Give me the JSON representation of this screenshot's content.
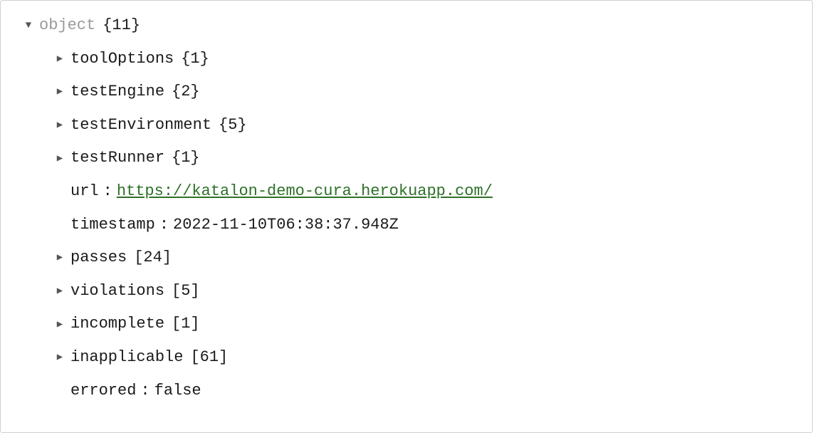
{
  "root": {
    "label": "object",
    "count": "{11}"
  },
  "children": [
    {
      "type": "expandable",
      "key": "toolOptions",
      "count": "{1}"
    },
    {
      "type": "expandable",
      "key": "testEngine",
      "count": "{2}"
    },
    {
      "type": "expandable",
      "key": "testEnvironment",
      "count": "{5}"
    },
    {
      "type": "expandable",
      "key": "testRunner",
      "count": "{1}"
    },
    {
      "type": "link",
      "key": "url",
      "value": "https://katalon-demo-cura.herokuapp.com/"
    },
    {
      "type": "value",
      "key": "timestamp",
      "value": "2022-11-10T06:38:37.948Z"
    },
    {
      "type": "expandable",
      "key": "passes",
      "count": "[24]"
    },
    {
      "type": "expandable",
      "key": "violations",
      "count": "[5]"
    },
    {
      "type": "expandable",
      "key": "incomplete",
      "count": "[1]"
    },
    {
      "type": "expandable",
      "key": "inapplicable",
      "count": "[61]"
    },
    {
      "type": "value",
      "key": "errored",
      "value": "false"
    }
  ],
  "glyphs": {
    "expanded": "▼",
    "collapsed": "▶"
  },
  "sep": ":"
}
